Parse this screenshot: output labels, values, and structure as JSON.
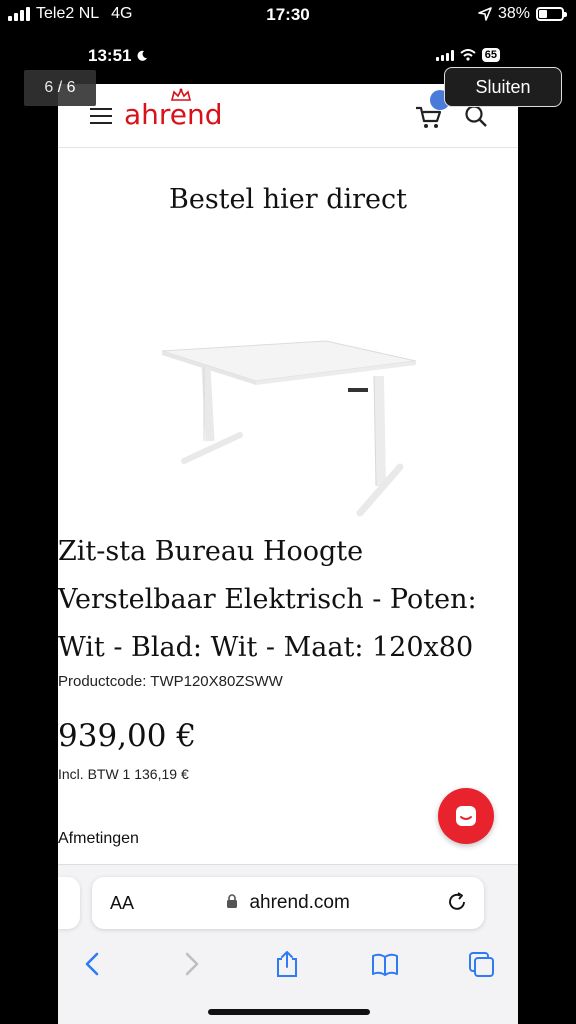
{
  "outer_status": {
    "carrier": "Tele2 NL",
    "network": "4G",
    "time": "17:30",
    "battery_percent": "38%",
    "battery_level": 0.38
  },
  "inner_status": {
    "time": "13:51",
    "battery": "65"
  },
  "viewer": {
    "counter": "6 / 6",
    "close_label": "Sluiten"
  },
  "site": {
    "logo_text": "ahrend",
    "brand_color": "#d8121b"
  },
  "page": {
    "heading": "Bestel hier direct",
    "product_title": "Zit-sta Bureau Hoogte Verstelbaar Elektrisch - Poten: Wit - Blad: Wit - Maat: 120x80",
    "product_code": "Productcode: TWP120X80ZSWW",
    "price": "939,00 €",
    "price_incl": "Incl. BTW 1 136,19 €",
    "dimensions_label": "Afmetingen"
  },
  "browser": {
    "aa_label": "AA",
    "url": "ahrend.com"
  },
  "icons": [
    "menu-icon",
    "cart-icon",
    "search-icon",
    "chat-icon",
    "lock-icon",
    "reload-icon",
    "back-icon",
    "forward-icon",
    "share-icon",
    "bookmarks-icon",
    "tabs-icon"
  ]
}
